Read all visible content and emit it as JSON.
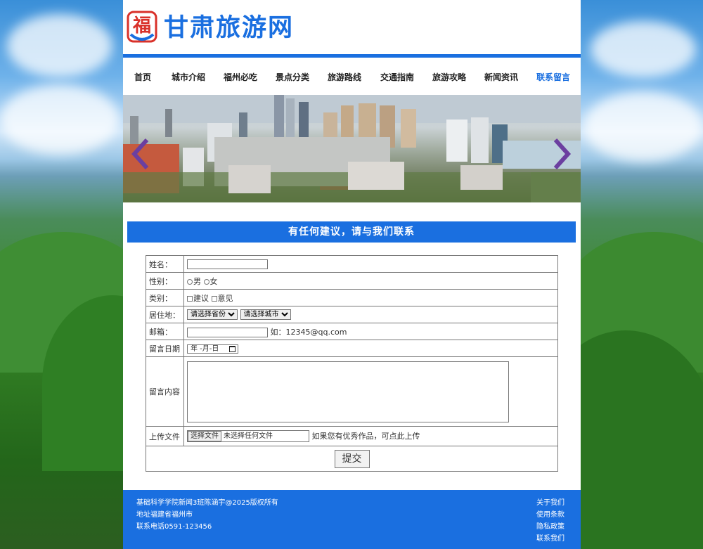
{
  "site": {
    "title": "甘肃旅游网",
    "logo_char": "福"
  },
  "nav": [
    "首页",
    "城市介绍",
    "福州必吃",
    "景点分类",
    "旅游路线",
    "交通指南",
    "旅游攻略",
    "新闻资讯",
    "联系留言"
  ],
  "section_title": "有任何建议，请与我们联系",
  "form": {
    "name_label": "姓名：",
    "gender_label": "性别：",
    "gender_options": [
      "男",
      "女"
    ],
    "type_label": "类别：",
    "type_options": [
      "建议",
      "意见"
    ],
    "residence_label": "居住地：",
    "province_select": "请选择省份",
    "city_select": "请选择城市",
    "email_label": "邮箱：",
    "email_hint": "如：12345@qq.com",
    "date_label": "留言日期",
    "date_placeholder": "年 -月-日",
    "message_label": "留言内容",
    "upload_label": "上传文件",
    "file_button": "选择文件",
    "file_status": "未选择任何文件",
    "upload_hint": "如果您有优秀作品，可点此上传",
    "submit_label": "提交"
  },
  "footer": {
    "copyright": "基础科学学院新闻3班陈涵宇@2025版权所有",
    "address": "地址福建省福州市",
    "phone": "联系电话0591-123456",
    "links": [
      "关于我们",
      "使用条款",
      "隐私政策",
      "联系我们"
    ]
  },
  "colors": {
    "brand": "#1a6fe0",
    "logo_red": "#d9312a",
    "arrow": "#6b3fa0"
  }
}
